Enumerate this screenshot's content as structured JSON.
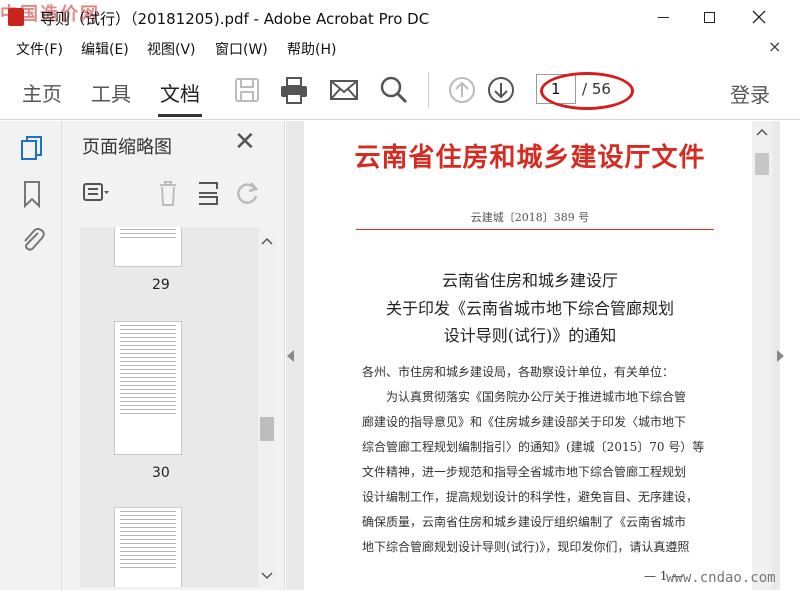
{
  "window": {
    "title": "导则（试行）（20181205).pdf - Adobe Acrobat Pro DC",
    "watermark": "中国造价网"
  },
  "menu": [
    "文件(F)",
    "编辑(E)",
    "视图(V)",
    "窗口(W)",
    "帮助(H)"
  ],
  "toolbar": {
    "tabs": [
      "主页",
      "工具",
      "文档"
    ],
    "active_tab": "文档",
    "page_current": "1",
    "page_total": "/ 56",
    "login": "登录"
  },
  "thumb_panel": {
    "title": "页面缩略图",
    "pages": [
      "29",
      "30"
    ]
  },
  "document": {
    "header": "云南省住房和城乡建设厅文件",
    "number": "云建城〔2018〕389 号",
    "title_lines": [
      "云南省住房和城乡建设厅",
      "关于印发《云南省城市地下综合管廊规划",
      "设计导则(试行)》的通知"
    ],
    "paragraphs": [
      "各州、市住房和城乡建设局，各勘察设计单位，有关单位：",
      "　　为认真贯彻落实《国务院办公厅关于推进城市地下综合管",
      "廊建设的指导意见》和《住房城乡建设部关于印发〈城市地下",
      "综合管廊工程规划编制指引〉的通知》(建城〔2015〕70 号）等",
      "文件精神，进一步规范和指导全省城市地下综合管廊工程规划",
      "设计编制工作，提高规划设计的科学性，避免盲目、无序建设，",
      "确保质量，云南省住房和城乡建设厅组织编制了《云南省城市",
      "地下综合管廊规划设计导则(试行)》，现印发你们，请认真遵照"
    ],
    "page_marker": "— 1 —"
  },
  "site_watermark": "www.cndao.com",
  "colors": {
    "accent_red": "#d72a20",
    "ellipse_red": "#d71c1c"
  }
}
